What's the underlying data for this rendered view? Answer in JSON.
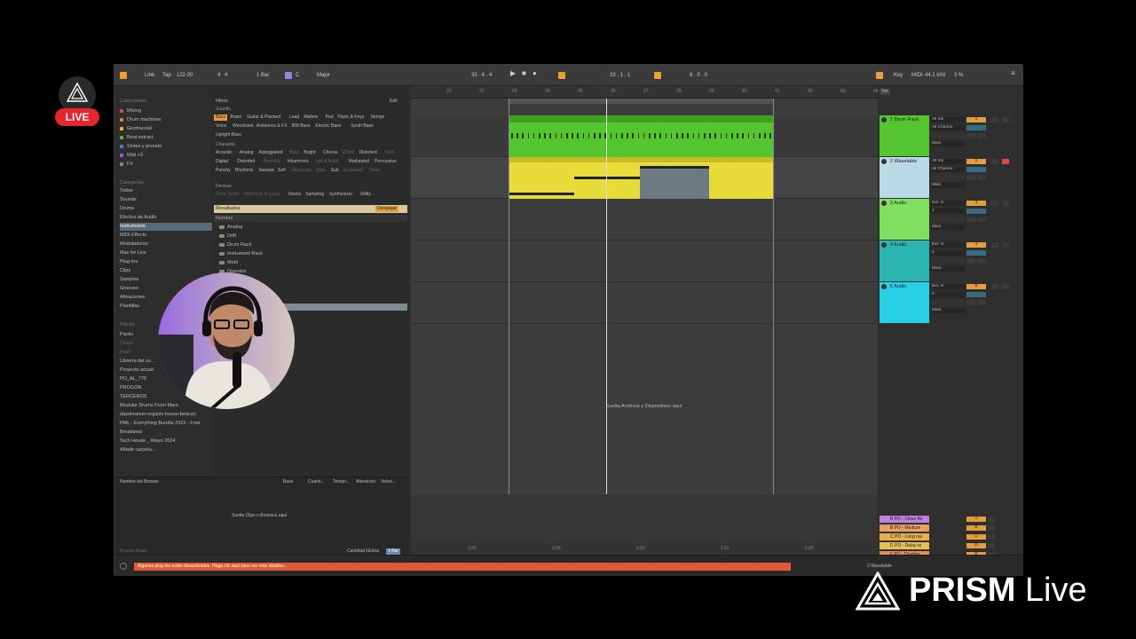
{
  "live_badge": {
    "label": "LIVE"
  },
  "topbar": {
    "link": "Link",
    "tap": "Tap",
    "tempo": "122.00",
    "signature_num": "4",
    "signature_den": "4",
    "quantize": "1 Bar",
    "key": "C",
    "scale": "Major",
    "position": "33 . 4 . 4",
    "loop_start": "33 . 1 . 1",
    "loop_length": "8 . 0 . 0",
    "key_mode": "Key",
    "midi": "MIDI",
    "sample_rate": "44.1 kHz",
    "cpu": "3 %"
  },
  "browser": {
    "collections_header": "Colecciones",
    "collections": [
      {
        "label": "Mixing",
        "color": "#e04848"
      },
      {
        "label": "Drum machines",
        "color": "#e08030"
      },
      {
        "label": "Geofraccial",
        "color": "#e0c030"
      },
      {
        "label": "Beat extract",
        "color": "#50c050"
      },
      {
        "label": "Sintes y presets",
        "color": "#4080e0"
      },
      {
        "label": "Midi +3",
        "color": "#9060e0"
      },
      {
        "label": "FX",
        "color": "#888888"
      }
    ],
    "categories_header": "Categorías",
    "categories": [
      {
        "label": "Todos"
      },
      {
        "label": "Sounds"
      },
      {
        "label": "Drums"
      },
      {
        "label": "Efectos de Audio"
      },
      {
        "label": "Instruments"
      },
      {
        "label": "MIDI Effects"
      },
      {
        "label": "Moduladores"
      },
      {
        "label": "Max for Live"
      },
      {
        "label": "Plug-Ins"
      },
      {
        "label": "Clips"
      },
      {
        "label": "Samples"
      },
      {
        "label": "Grooves"
      },
      {
        "label": "Afinaciones"
      },
      {
        "label": "Plantillas"
      }
    ],
    "places_header": "Places",
    "places": [
      {
        "label": "Packs"
      },
      {
        "label": "Cloud"
      },
      {
        "label": "Push"
      },
      {
        "label": "Librería del us..."
      },
      {
        "label": "Proyecto actual"
      },
      {
        "label": "PO_AL_778"
      },
      {
        "label": "PROGON"
      },
      {
        "label": "TERCEROS"
      },
      {
        "label": "Modular Drums From Mars"
      },
      {
        "label": "daydreamer-organic-house-beta-pc"
      },
      {
        "label": "PML - Everything Bundle 2023 - Free"
      },
      {
        "label": "Breakbeat"
      },
      {
        "label": "Tech House _ Mayo 2024"
      },
      {
        "label": "Añadir carpeta..."
      }
    ],
    "filters_label": "Filtros",
    "edit_label": "Edit",
    "sounds_label": "Sounds",
    "sounds_chips": [
      "Bass",
      "Brass",
      "Guitar & Plucked",
      "Lead",
      "Mallets",
      "Pad",
      "Piano & Keys",
      "Strings",
      "Voice",
      "Woodwind",
      "Ambience & FX",
      "808 Bass",
      "Electric Bass",
      "Synth Bass",
      "Upright Bass"
    ],
    "character_label": "Character",
    "character_chips": [
      "Acoustic",
      "Analog",
      "Arpeggiated",
      "Bass",
      "Bright",
      "Chorus",
      "Chord",
      "Distorted",
      "Dark",
      "Digital",
      "Distorted",
      "Evolving",
      "Inharmonic",
      "Left & Right",
      "Modulated",
      "Percussive",
      "Punchy",
      "Rhythmic",
      "Sweeps",
      "Soft",
      "Resonant",
      "Slow",
      "Sub",
      "Sustained",
      "Tonal"
    ],
    "devices_label": "Devices",
    "devices_chips": [
      "Drum Synth",
      "Harmonic & Lyrics",
      "Racks",
      "Sampling",
      "Synthesizer",
      "Utility"
    ],
    "results_label": "Resultados",
    "results_action": "Despejar",
    "name_header": "Nombre",
    "results": [
      "Analog",
      "Drift",
      "Drum Rack",
      "Instrument Rack",
      "Meld",
      "Operator"
    ],
    "table_cols": [
      "Nombre del Browse",
      "Base",
      "Cuanti...",
      "Tempo...",
      "Alteración",
      "Veloci..."
    ],
    "table_drop": "Suelta Clips o Browses aquí",
    "footer_left": "Browse Road",
    "footer_right": "Cantidad Global",
    "footer_value": "1 Bar"
  },
  "arrangement": {
    "ruler": [
      "21",
      "22",
      "23",
      "24",
      "25",
      "26",
      "27",
      "28",
      "29",
      "40",
      "41",
      "42",
      "43",
      "44"
    ],
    "drop_text": "Suelta Archivos y Dispositivos aquí",
    "bottom_times": [
      "1:00",
      "1:05",
      "1:10",
      "1:15",
      "1:20"
    ]
  },
  "tracks": [
    {
      "name": "1 Drum Rack",
      "color": "#55c52f",
      "input": "All Ins",
      "input2": "All Channe",
      "out": "Main",
      "num": "1"
    },
    {
      "name": "2 Wavetable",
      "color": "#b9d9e6",
      "input": "All Ins",
      "input2": "All Channe",
      "out": "Main",
      "num": "2"
    },
    {
      "name": "3 Audio",
      "color": "#7fe060",
      "input": "Ext. In",
      "input2": "1",
      "out": "Main",
      "num": "3"
    },
    {
      "name": "4 Audio",
      "color": "#2ab5b0",
      "input": "Ext. In",
      "input2": "3",
      "out": "Main",
      "num": "4"
    },
    {
      "name": "5 Audio",
      "color": "#28d0e8",
      "input": "Ext. In",
      "input2": "5",
      "out": "Main",
      "num": "5"
    }
  ],
  "returns": [
    {
      "name": "B PO - Close Re",
      "color": "#c080e0",
      "letter": "A"
    },
    {
      "name": "B PO - Medium",
      "color": "#e8a060",
      "letter": "B"
    },
    {
      "name": "C PO - Long rev",
      "color": "#e8b048",
      "letter": "C"
    },
    {
      "name": "D PO - Delay re",
      "color": "#e8c050",
      "letter": "D"
    },
    {
      "name": "F PO - Doubler",
      "color": "#e09050",
      "letter": "E"
    },
    {
      "name": "Main",
      "color": "#d8e040",
      "letter": "1/2"
    }
  ],
  "mixer_misc": {
    "set_label": "Set",
    "ratio": "1/4",
    "main_value": "0.00"
  },
  "status": {
    "message": "Algunos plug-ins están desactivados. Haga clic aquí para ver más detalles.",
    "track_name": "2-Wavetable"
  },
  "prism": {
    "bold": "PRISM",
    "light": "Live"
  }
}
